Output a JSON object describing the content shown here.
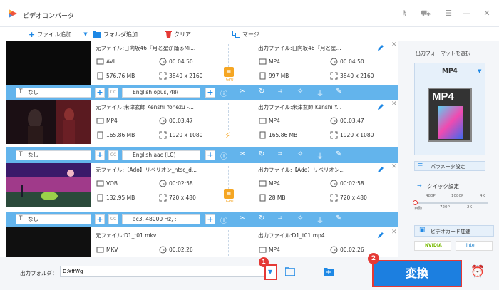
{
  "app": {
    "title": "ビデオコンバータ"
  },
  "colors": {
    "accent": "#1e88e5",
    "ctrl_bar": "#63b4ec",
    "convert": "#1c7fe0",
    "callout": "#e53935"
  },
  "toolbar": {
    "add_file": "ファイル追加",
    "add_folder": "フォルダ追加",
    "clear": "クリア",
    "merge": "マージ"
  },
  "labels": {
    "source": "元ファイル:",
    "output": "出力ファイル:"
  },
  "rows": [
    {
      "src_name": "日向坂46『月と星が踊るMi...",
      "src_fmt": "AVI",
      "src_dur": "00:04:50",
      "src_size": "576.76 MB",
      "src_res": "3840 x 2160",
      "out_name": "日向坂46『月と星...",
      "out_fmt": "MP4",
      "out_dur": "00:04:50",
      "out_size": "997 MB",
      "out_res": "3840 x 2160",
      "accel": "GPU",
      "sub": "なし",
      "audio": "English opus, 48("
    },
    {
      "src_name": "米津玄師 Kenshi Yonezu -...",
      "src_fmt": "MP4",
      "src_dur": "00:03:47",
      "src_size": "165.86 MB",
      "src_res": "1920 x 1080",
      "out_name": "米津玄師 Kenshi Y...",
      "out_fmt": "MP4",
      "out_dur": "00:03:47",
      "out_size": "165.86 MB",
      "out_res": "1920 x 1080",
      "accel": "",
      "sub": "なし",
      "audio": "English aac (LC)"
    },
    {
      "src_name": "【Ado】リベリオン_ntsc_d...",
      "src_fmt": "VOB",
      "src_dur": "00:02:58",
      "src_size": "132.95 MB",
      "src_res": "720 x 480",
      "out_name": "【Ado】リベリオン...",
      "out_fmt": "MP4",
      "out_dur": "00:02:58",
      "out_size": "28 MB",
      "out_res": "720 x 480",
      "accel": "GPU",
      "sub": "なし",
      "audio": "ac3, 48000 Hz, :"
    },
    {
      "src_name": "D1_t01.mkv",
      "src_fmt": "MKV",
      "src_dur": "00:02:26",
      "src_size": "",
      "src_res": "",
      "out_name": "D1_t01.mp4",
      "out_fmt": "MP4",
      "out_dur": "00:02:26",
      "out_size": "",
      "out_res": "",
      "accel": "",
      "sub": "",
      "audio": ""
    }
  ],
  "panel": {
    "output_format_label": "出力フォーマットを選択",
    "format_selected": "MP4",
    "format_badge": "MP4",
    "param_settings": "パラメータ設定",
    "quick_settings": "クイック設定",
    "quality_ticks_top": [
      "480P",
      "1080P",
      "4K"
    ],
    "quality_ticks_bottom": [
      "自動",
      "720P",
      "2K"
    ],
    "gpu_accel": "ビデオカード加速",
    "nvidia": "NVIDIA",
    "intel": "intel"
  },
  "bottom": {
    "output_folder_label": "出力フォルダ：",
    "path_value": "D:¥ffWg",
    "convert": "変換",
    "callout1": "1",
    "callout2": "2"
  }
}
